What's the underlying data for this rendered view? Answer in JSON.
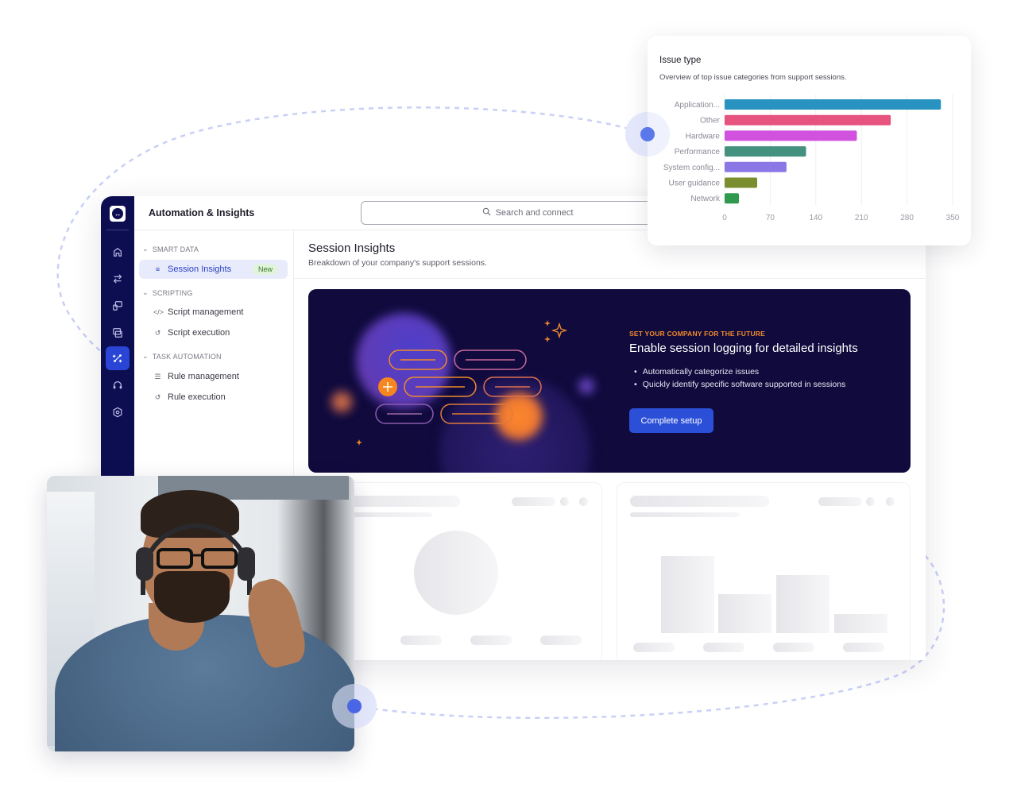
{
  "app": {
    "title": "Automation & Insights",
    "search_placeholder": "Search and connect"
  },
  "rail": {
    "items": [
      {
        "icon": "home-icon",
        "active": false
      },
      {
        "icon": "transfer-icon",
        "active": false
      },
      {
        "icon": "remote-device-icon",
        "active": false
      },
      {
        "icon": "screen-share-icon",
        "active": false
      },
      {
        "icon": "automation-icon",
        "active": true
      },
      {
        "icon": "headset-support-icon",
        "active": false
      },
      {
        "icon": "settings-shield-icon",
        "active": false
      }
    ]
  },
  "nav": {
    "sections": [
      {
        "label": "SMART DATA",
        "items": [
          {
            "label": "Session Insights",
            "icon": "insights-icon",
            "badge": "New",
            "active": true
          }
        ]
      },
      {
        "label": "SCRIPTING",
        "items": [
          {
            "label": "Script management",
            "icon": "code-icon"
          },
          {
            "label": "Script execution",
            "icon": "history-icon"
          }
        ]
      },
      {
        "label": "TASK AUTOMATION",
        "items": [
          {
            "label": "Rule management",
            "icon": "checklist-icon"
          },
          {
            "label": "Rule execution",
            "icon": "history-icon"
          }
        ]
      }
    ]
  },
  "page": {
    "title": "Session Insights",
    "subtitle": "Breakdown of your company's support sessions."
  },
  "promo": {
    "eyebrow": "SET YOUR COMPANY FOR THE FUTURE",
    "title": "Enable session logging for detailed insights",
    "bullets": [
      "Automatically categorize issues",
      "Quickly identify specific software supported in sessions"
    ],
    "button": "Complete setup",
    "colors": {
      "background": "#100a3d",
      "accent": "#f08a2c",
      "button": "#2c4fd8"
    }
  },
  "issue_card": {
    "title": "Issue type",
    "subtitle": "Overview of top issue categories from support sessions."
  },
  "chart_data": {
    "type": "bar",
    "orientation": "horizontal",
    "title": "Issue type",
    "subtitle": "Overview of top issue categories from support sessions.",
    "categories": [
      "Application...",
      "Other",
      "Hardware",
      "Performance",
      "System config...",
      "User guidance",
      "Network"
    ],
    "values": [
      332,
      255,
      203,
      125,
      95,
      50,
      22
    ],
    "colors": [
      "#2893c0",
      "#e5537e",
      "#d152df",
      "#45917f",
      "#8b78e6",
      "#7a8e30",
      "#2f9a4d"
    ],
    "xticks": [
      "0",
      "70",
      "140",
      "210",
      "280",
      "350"
    ],
    "xlim": [
      0,
      350
    ],
    "grid": true,
    "legend": "none",
    "xlabel": "",
    "ylabel": ""
  }
}
